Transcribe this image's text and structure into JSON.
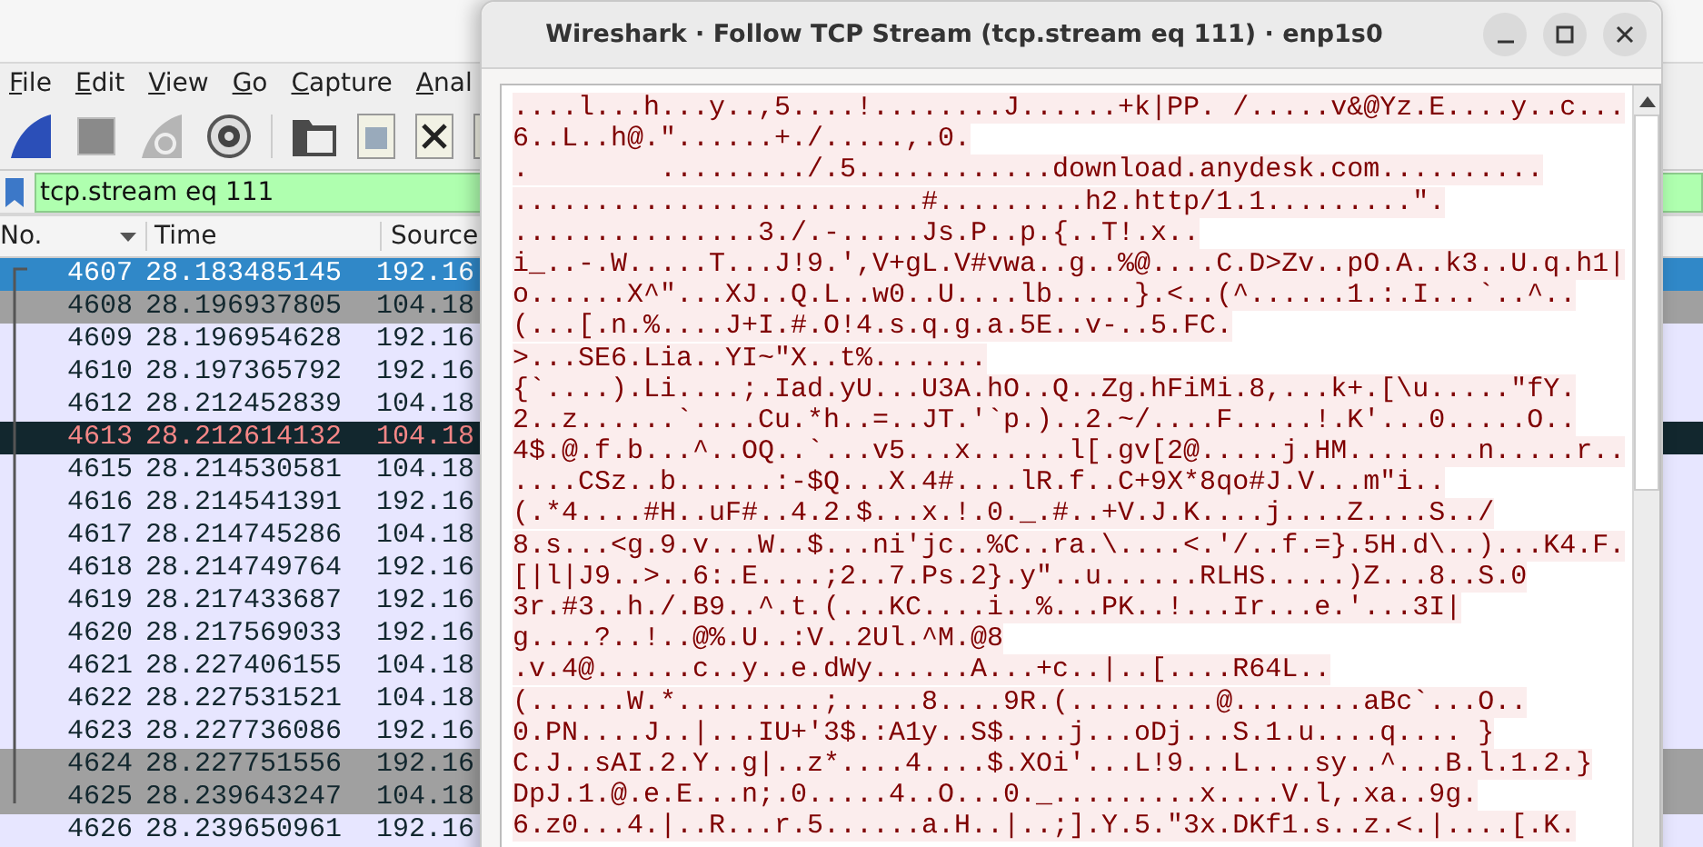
{
  "main_window": {
    "menu": [
      "File",
      "Edit",
      "View",
      "Go",
      "Capture",
      "Anal"
    ],
    "display_filter": {
      "value": "tcp.stream eq 111"
    },
    "packet_list": {
      "columns": [
        "No.",
        "Time",
        "Source"
      ],
      "rows": [
        {
          "no": "4607",
          "time": "28.183485145",
          "source": "192.16",
          "selected": true,
          "kind": "normal"
        },
        {
          "no": "4608",
          "time": "28.196937805",
          "source": "104.18",
          "selected": false,
          "kind": "grey"
        },
        {
          "no": "4609",
          "time": "28.196954628",
          "source": "192.16",
          "selected": false,
          "kind": "normal"
        },
        {
          "no": "4610",
          "time": "28.197365792",
          "source": "192.16",
          "selected": false,
          "kind": "normal"
        },
        {
          "no": "4612",
          "time": "28.212452839",
          "source": "104.18",
          "selected": false,
          "kind": "normal"
        },
        {
          "no": "4613",
          "time": "28.212614132",
          "source": "104.18",
          "selected": false,
          "kind": "error"
        },
        {
          "no": "4615",
          "time": "28.214530581",
          "source": "104.18",
          "selected": false,
          "kind": "normal"
        },
        {
          "no": "4616",
          "time": "28.214541391",
          "source": "192.16",
          "selected": false,
          "kind": "normal"
        },
        {
          "no": "4617",
          "time": "28.214745286",
          "source": "104.18",
          "selected": false,
          "kind": "normal"
        },
        {
          "no": "4618",
          "time": "28.214749764",
          "source": "192.16",
          "selected": false,
          "kind": "normal"
        },
        {
          "no": "4619",
          "time": "28.217433687",
          "source": "192.16",
          "selected": false,
          "kind": "normal"
        },
        {
          "no": "4620",
          "time": "28.217569033",
          "source": "192.16",
          "selected": false,
          "kind": "normal"
        },
        {
          "no": "4621",
          "time": "28.227406155",
          "source": "104.18",
          "selected": false,
          "kind": "normal"
        },
        {
          "no": "4622",
          "time": "28.227531521",
          "source": "104.18",
          "selected": false,
          "kind": "normal"
        },
        {
          "no": "4623",
          "time": "28.227736086",
          "source": "192.16",
          "selected": false,
          "kind": "normal"
        },
        {
          "no": "4624",
          "time": "28.227751556",
          "source": "192.16",
          "selected": false,
          "kind": "grey"
        },
        {
          "no": "4625",
          "time": "28.239643247",
          "source": "104.18",
          "selected": false,
          "kind": "grey"
        },
        {
          "no": "4626",
          "time": "28.239650961",
          "source": "192.16",
          "selected": false,
          "kind": "normal"
        }
      ]
    }
  },
  "dialog": {
    "title": "Wireshark · Follow TCP Stream (tcp.stream eq 111) · enp1s0",
    "stream_lines": [
      "....l...h...y..,5....!........J......+k|PP. /.....v&@Yz.E....y..c...",
      "6..L..h@.\"......+./.....,.0.",
      ".        ........./.5............download.anydesk.com..........",
      ".........................#.........h2.http/1.1.........\".",
      "...............3./.-.....Js.P..p.{..T!.x..",
      "i_..-.W.....T...J!9.',V+gL.V#vwa..g..%@....C.D>Zv..pO.A..k3..U.q.h1|",
      "o......X^\"...XJ..Q.L..w0..U....lb.....}.<..(^......1.:.I...`..^..",
      "(...[.n.%....J+I.#.O!4.s.q.g.a.5E..v-..5.FC.",
      ">...SE6.Lia..YI~\"X..t%.......",
      "{`....).Li....;.Iad.yU...U3A.hO..Q..Zg.hFiMi.8,...k+.[\\u.....\"fY.",
      "2..z......`....Cu.*h..=..JT.'`p.)..2.~/....F.....!.K'...0.....O..",
      "4$.@.f.b...^..OQ..`...v5...x......l[.gv[2@.....j.HM........n.....r..",
      "....CSz..b......:-$Q...X.4#....lR.f..C+9X*8qo#J.V...m\"i..",
      "(.*4....#H..uF#..4.2.$...x.!.0._.#..+V.J.K....j....Z....S../",
      "8.s...<g.9.v...W..$...ni'jc..%C..ra.\\....<.'/..f.=}.5H.d\\..)...K4.F.",
      "[|l|J9..>..6:.E....;2..7.Ps.2}.y\"..u......RLHS.....)Z...8..S.0",
      "3r.#3..h./.B9..^.t.(...KC....i..%...PK..!...Ir...e.'...3I|",
      "g....?..!..@%.U..:V..2Ul.^M.@8",
      ".v.4@......c..y..e.dWy......A...+c..|..[....R64L..",
      "(......W.*.........;.....8....9R.(.........@........aBc`...O..",
      "0.PN....J..|...IU+'3$.:A1y..S$....j...oDj...S.1.u....q.... }",
      "C.J..sAI.2.Y..g|..z*....4....$.XOi'...L!9...L....sy..^...B.l.1.2.}",
      "DpJ.1.@.e.E...n;.0.....4..O...0._.........x....V.l,.xa..9g.",
      "6.z0...4.|..R...r.5......a.H..|..;].Y.5.\"3x.DKf1.s..z.<.|....[.K."
    ]
  }
}
